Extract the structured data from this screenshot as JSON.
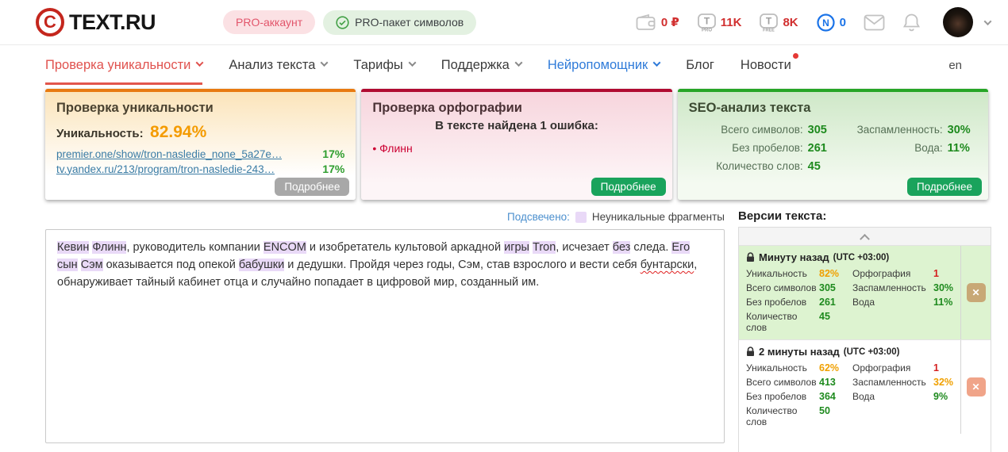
{
  "header": {
    "logo": "TEXT.RU",
    "logo_letter": "C",
    "account_badge": "PRO-аккаунт",
    "package_badge": "PRO-пакет символов",
    "wallet_balance": "0 ₽",
    "t_pro_balance": "11K",
    "t_pro_sub": "PRO",
    "t_free_balance": "8K",
    "t_free_sub": "FREE",
    "t_letter": "T",
    "neuro_letter": "N",
    "neuro_balance": "0"
  },
  "nav": {
    "items": [
      {
        "label": "Проверка уникальности",
        "chevron": true,
        "accent": "active"
      },
      {
        "label": "Анализ текста",
        "chevron": true
      },
      {
        "label": "Тарифы",
        "chevron": true
      },
      {
        "label": "Поддержка",
        "chevron": true
      },
      {
        "label": "Нейропомощник",
        "chevron": true,
        "accent": "blue"
      },
      {
        "label": "Блог"
      },
      {
        "label": "Новости",
        "dot": true
      }
    ],
    "lang": "en"
  },
  "cards": {
    "uniqueness": {
      "title": "Проверка уникальности",
      "label": "Уникальность:",
      "value": "82.94%",
      "links": [
        {
          "url": "premier.one/show/tron-nasledie_none_5a27e…",
          "match": "17%"
        },
        {
          "url": "tv.yandex.ru/213/program/tron-nasledie-243…",
          "match": "17%"
        }
      ],
      "more": "Подробнее"
    },
    "spelling": {
      "title": "Проверка орфографии",
      "subtitle": "В тексте найдена 1 ошибка:",
      "errors": [
        "Флинн"
      ],
      "more": "Подробнее"
    },
    "seo": {
      "title": "SEO-анализ текста",
      "rows": [
        [
          "Всего символов:",
          "305",
          "Заспамленность:",
          "30%"
        ],
        [
          "Без пробелов:",
          "261",
          "Вода:",
          "11%"
        ],
        [
          "Количество слов:",
          "45",
          "",
          ""
        ]
      ],
      "more": "Подробнее"
    }
  },
  "legend": {
    "highlighted_label": "Подсвечено:",
    "swatch_label": "Неуникальные фрагменты"
  },
  "editor": {
    "segments": [
      {
        "t": "Кевин",
        "hl": true
      },
      {
        "t": " "
      },
      {
        "t": "Флинн",
        "hl": true
      },
      {
        "t": ", руководитель компании "
      },
      {
        "t": "ENCOM",
        "hl": true
      },
      {
        "t": " и изобретатель культовой аркадной "
      },
      {
        "t": "игры",
        "hl": true
      },
      {
        "t": " "
      },
      {
        "t": "Tron",
        "hl": true
      },
      {
        "t": ", исчезает "
      },
      {
        "t": "без",
        "hl": true
      },
      {
        "t": " следа. "
      },
      {
        "t": "Его",
        "hl": true
      },
      {
        "t": " "
      },
      {
        "t": "сын",
        "hl": true
      },
      {
        "t": " "
      },
      {
        "t": "Сэм",
        "hl": true
      },
      {
        "t": " оказывается под опекой "
      },
      {
        "t": "бабушки",
        "hl": true
      },
      {
        "t": " и дедушки. Пройдя через годы, Сэм, став взрослого и вести себя "
      },
      {
        "t": "бунтарски",
        "err": true
      },
      {
        "t": ", обнаруживает тайный кабинет отца и случайно попадает в цифровой мир, созданный им."
      }
    ]
  },
  "versions": {
    "title": "Версии текста:",
    "items": [
      {
        "time": "Минуту назад",
        "utc": "(UTC +03:00)",
        "highlighted": true,
        "rows": [
          [
            {
              "l": "Уникальность",
              "v": "82%",
              "c": "orange"
            },
            {
              "l": "Орфография",
              "v": "1",
              "c": "red"
            }
          ],
          [
            {
              "l": "Всего символов",
              "v": "305",
              "c": "green"
            },
            {
              "l": "Заспамленность",
              "v": "30%",
              "c": "green"
            }
          ],
          [
            {
              "l": "Без пробелов",
              "v": "261",
              "c": "green"
            },
            {
              "l": "Вода",
              "v": "11%",
              "c": "green"
            }
          ],
          [
            {
              "l": "Количество слов",
              "v": "45",
              "c": "green"
            },
            null
          ]
        ]
      },
      {
        "time": "2 минуты назад",
        "utc": "(UTC +03:00)",
        "highlighted": false,
        "rows": [
          [
            {
              "l": "Уникальность",
              "v": "62%",
              "c": "orange"
            },
            {
              "l": "Орфография",
              "v": "1",
              "c": "red"
            }
          ],
          [
            {
              "l": "Всего символов",
              "v": "413",
              "c": "green"
            },
            {
              "l": "Заспамленность",
              "v": "32%",
              "c": "orange"
            }
          ],
          [
            {
              "l": "Без пробелов",
              "v": "364",
              "c": "green"
            },
            {
              "l": "Вода",
              "v": "9%",
              "c": "green"
            }
          ],
          [
            {
              "l": "Количество слов",
              "v": "50",
              "c": "green"
            },
            null
          ]
        ]
      }
    ]
  },
  "colors": {
    "brand_red": "#c4261d",
    "accent_red": "#e0524e",
    "nav_blue": "#2f7bd9",
    "link_blue": "#3a7ca5",
    "value_green": "#1e8a1e",
    "button_green": "#1aa35c",
    "warn_orange": "#f49b00",
    "error_red": "#cc0033",
    "highlight_lavender": "#e9d9f7",
    "uniq_card_border": "#e87a10",
    "spell_card_border": "#b00b31",
    "seo_card_border": "#27a527"
  }
}
